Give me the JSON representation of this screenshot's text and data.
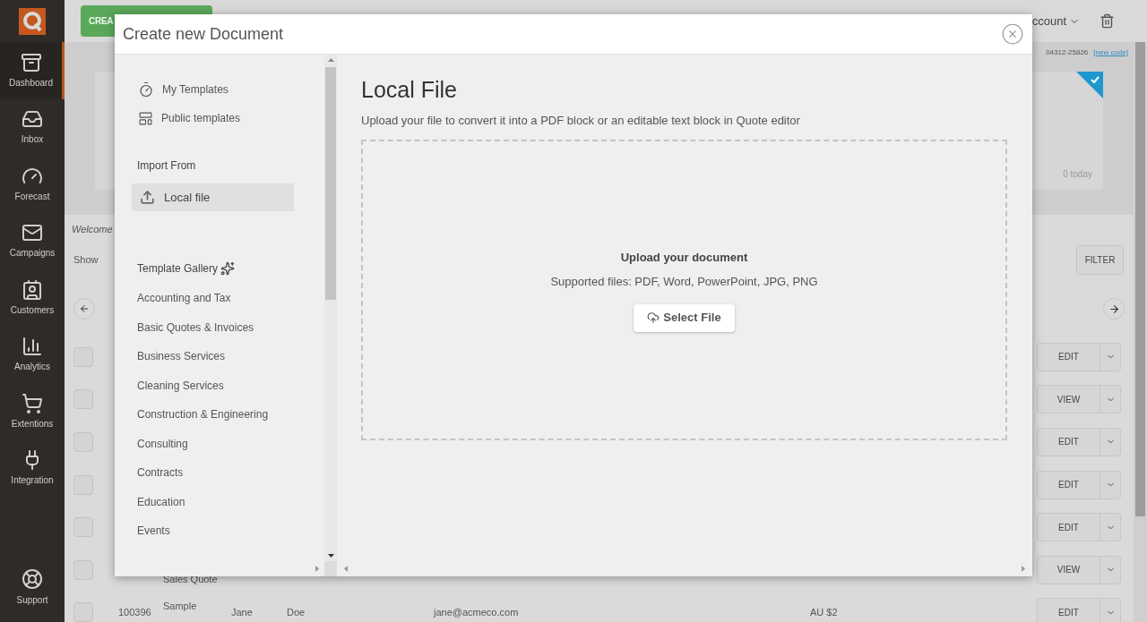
{
  "sidebar": {
    "items": [
      {
        "label": "Dashboard",
        "selected": true
      },
      {
        "label": "Inbox",
        "selected": false
      },
      {
        "label": "Forecast",
        "selected": false
      },
      {
        "label": "Campaigns",
        "selected": false
      },
      {
        "label": "Customers",
        "selected": false
      },
      {
        "label": "Analytics",
        "selected": false
      },
      {
        "label": "Extentions",
        "selected": false
      },
      {
        "label": "Integration",
        "selected": false
      }
    ],
    "support": {
      "label": "Support"
    }
  },
  "topbar": {
    "create_button": "CREA",
    "account_menu": "ccount"
  },
  "page": {
    "code": "04312-25826",
    "new_code_link": "[new code]",
    "stat_card": {
      "caption": "0 today",
      "checked": true
    },
    "welcome": "Welcome",
    "show_label": "Show",
    "filter_button": "FILTER",
    "rows": [
      {
        "checked": false,
        "action": "EDIT",
        "cells": []
      },
      {
        "checked": false,
        "action": "VIEW",
        "cells": []
      },
      {
        "checked": false,
        "action": "EDIT",
        "cells": []
      },
      {
        "checked": false,
        "action": "EDIT",
        "cells": []
      },
      {
        "checked": false,
        "action": "EDIT",
        "cells": []
      },
      {
        "checked": false,
        "action": "VIEW",
        "cells": [
          "",
          "Sales Quote"
        ]
      },
      {
        "checked": false,
        "action": "EDIT",
        "cells": [
          "100396",
          "Sample",
          "Jane",
          "Doe",
          "jane@acmeco.com",
          "AU $2"
        ]
      }
    ]
  },
  "dialog": {
    "title": "Create new Document",
    "nav": [
      {
        "label": "My Templates"
      },
      {
        "label": "Public templates"
      }
    ],
    "import_heading": "Import From",
    "import_items": [
      {
        "label": "Local file",
        "selected": true
      }
    ],
    "gallery_heading": "Template Gallery",
    "gallery": [
      "Accounting and Tax",
      "Basic Quotes & Invoices",
      "Business Services",
      "Cleaning Services",
      "Construction & Engineering",
      "Consulting",
      "Contracts",
      "Education",
      "Events"
    ],
    "content": {
      "heading": "Local File",
      "description": "Upload your file to convert it into a PDF block or an editable text block in Quote editor",
      "drop_title": "Upload your document",
      "drop_hint": "Supported files: PDF, Word, PowerPoint, JPG, PNG",
      "select_button": "Select File"
    }
  }
}
